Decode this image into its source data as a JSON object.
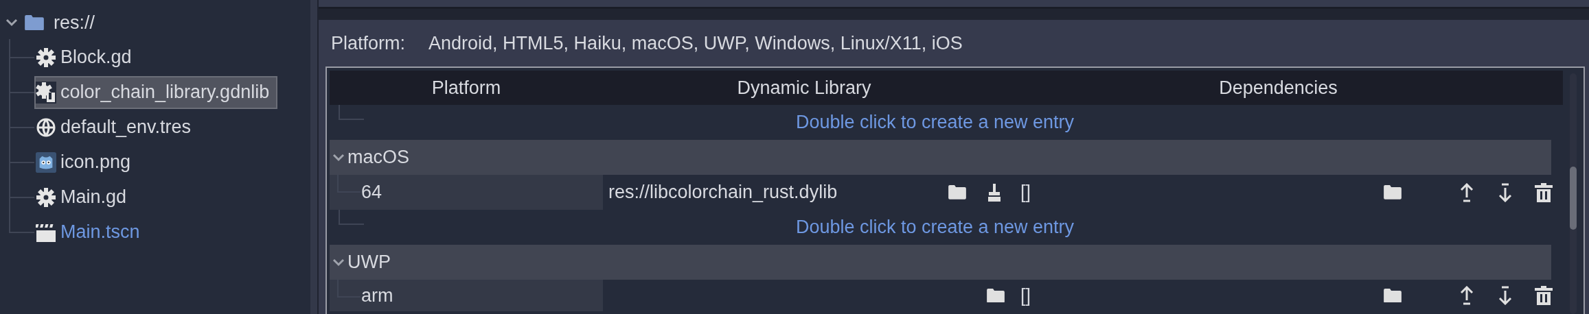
{
  "file_tree": {
    "label": "res://",
    "expanded": true,
    "children": [
      {
        "label": "Block.gd",
        "kind": "script",
        "selected": false
      },
      {
        "label": "color_chain_library.gdnlib",
        "kind": "library",
        "selected": true
      },
      {
        "label": "default_env.tres",
        "kind": "environment",
        "selected": false
      },
      {
        "label": "icon.png",
        "kind": "image",
        "selected": false
      },
      {
        "label": "Main.gd",
        "kind": "script",
        "selected": false
      },
      {
        "label": "Main.tscn",
        "kind": "scene",
        "selected": false
      }
    ]
  },
  "inspector": {
    "platform_label": "Platform:",
    "platform_value": "Android, HTML5, Haiku, macOS, UWP, Windows, Linux/X11, iOS",
    "table": {
      "columns": [
        "Platform",
        "Dynamic Library",
        "Dependencies"
      ],
      "rows": [
        {
          "kind": "new_entry",
          "text": "Double click to create a new entry"
        },
        {
          "kind": "group",
          "label": "macOS",
          "expanded": true
        },
        {
          "kind": "entry",
          "platform": "64",
          "library": "res://libcolorchain_rust.dylib",
          "dependencies": "[]"
        },
        {
          "kind": "new_entry",
          "text": "Double click to create a new entry"
        },
        {
          "kind": "group",
          "label": "UWP",
          "expanded": true
        },
        {
          "kind": "entry",
          "platform": "arm",
          "dependencies": "[]"
        }
      ]
    }
  }
}
